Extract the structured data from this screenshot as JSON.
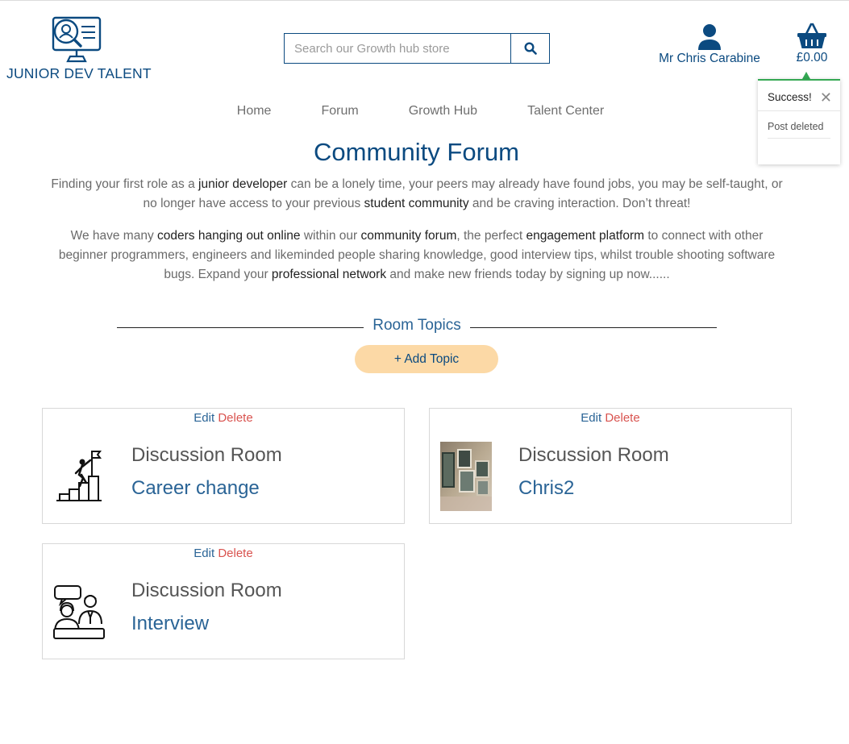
{
  "header": {
    "logo_text": "JUNIOR DEV TALENT",
    "search_placeholder": "Search our Growth hub store",
    "account_name": "Mr Chris Carabine",
    "basket_total": "£0.00"
  },
  "toast": {
    "title": "Success!",
    "message": "Post deleted"
  },
  "nav": {
    "items": [
      "Home",
      "Forum",
      "Growth Hub",
      "Talent Center"
    ]
  },
  "main": {
    "title": "Community Forum",
    "p1_a": "Finding your first role as a ",
    "p1_b1": "junior developer",
    "p1_c": " can be a lonely time, your peers may already have found jobs, you may be self-taught, or no longer have access to your previous ",
    "p1_b2": "student community",
    "p1_d": " and be craving interaction. Don’t threat!",
    "p2_a": "We have many ",
    "p2_b1": "coders hanging out online",
    "p2_c": " within our ",
    "p2_b2": "community forum",
    "p2_d": ", the perfect ",
    "p2_b3": "engagement platform",
    "p2_e": " to connect with other beginner programmers, engineers and likeminded people sharing knowledge, good interview tips, whilst trouble shooting software bugs. Expand your ",
    "p2_b4": "professional network",
    "p2_f": " and make new friends today by signing up now......",
    "topics_label": "Room Topics",
    "add_topic_label": "+ Add Topic"
  },
  "rooms": [
    {
      "edit": "Edit",
      "delete": "Delete",
      "room_label": "Discussion Room",
      "topic": "Career change",
      "icon": "career-climb-icon"
    },
    {
      "edit": "Edit",
      "delete": "Delete",
      "room_label": "Discussion Room",
      "topic": "Chris2",
      "icon": "photo-frames-image"
    },
    {
      "edit": "Edit",
      "delete": "Delete",
      "room_label": "Discussion Room",
      "topic": "Interview",
      "icon": "interview-icon"
    }
  ],
  "colors": {
    "brand": "#0b4a80",
    "link": "#2a6496",
    "delete": "#d9534f",
    "add_topic_bg": "#fcd9a6",
    "toast_accent": "#34a853"
  }
}
